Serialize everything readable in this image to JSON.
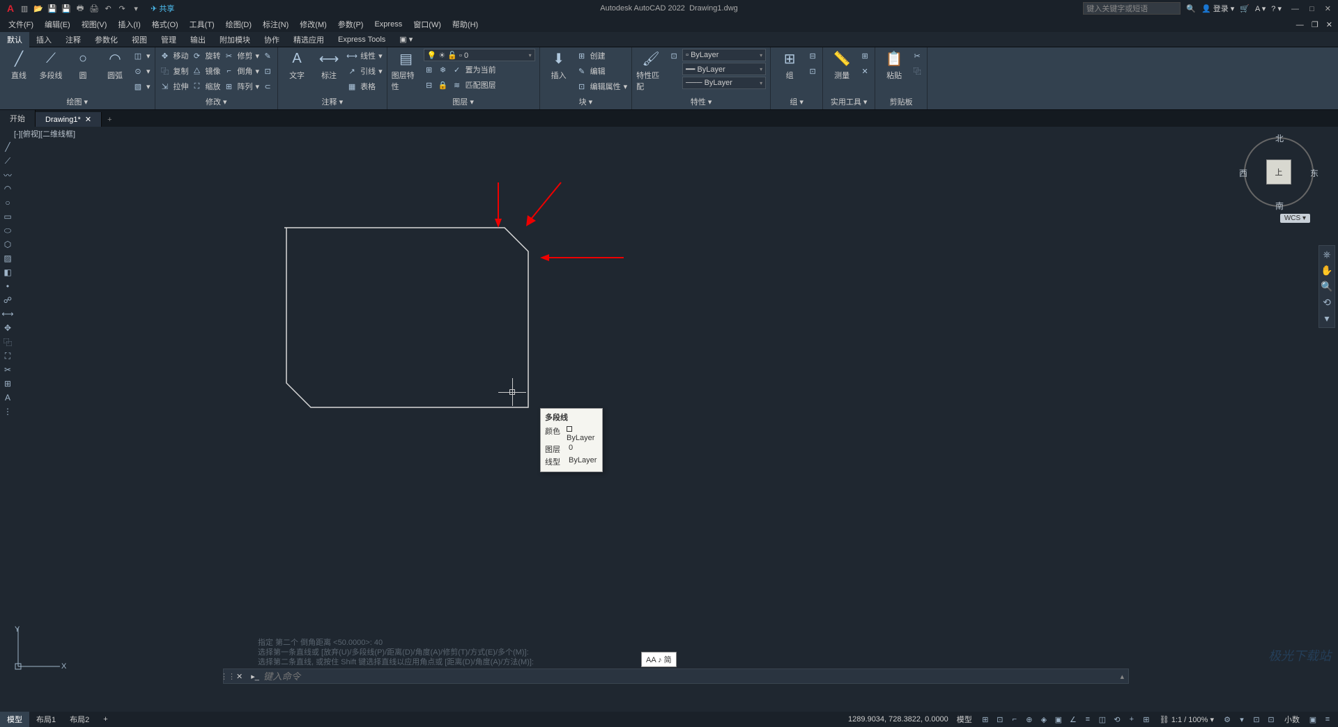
{
  "title": {
    "app": "Autodesk AutoCAD 2022",
    "file": "Drawing1.dwg"
  },
  "qat_share": "共享",
  "search_placeholder": "键入关键字或短语",
  "login": "登录",
  "menus": [
    "文件(F)",
    "编辑(E)",
    "视图(V)",
    "插入(I)",
    "格式(O)",
    "工具(T)",
    "绘图(D)",
    "标注(N)",
    "修改(M)",
    "参数(P)",
    "Express",
    "窗口(W)",
    "帮助(H)"
  ],
  "ribbon_tabs": [
    "默认",
    "插入",
    "注释",
    "参数化",
    "视图",
    "管理",
    "输出",
    "附加模块",
    "协作",
    "精选应用",
    "Express Tools"
  ],
  "panels": {
    "draw": {
      "title": "绘图",
      "line": "直线",
      "pline": "多段线",
      "circle": "圆",
      "arc": "圆弧"
    },
    "modify": {
      "title": "修改",
      "move": "移动",
      "rotate": "旋转",
      "trim": "修剪",
      "copy": "复制",
      "mirror": "镜像",
      "fillet": "倒角",
      "stretch": "拉伸",
      "scale": "缩放",
      "array": "阵列"
    },
    "annot": {
      "title": "注释",
      "text": "文字",
      "dim": "标注",
      "linear": "线性",
      "leader": "引线",
      "table": "表格"
    },
    "layers": {
      "title": "图层",
      "props": "图层特性",
      "current": "0",
      "freeze": "冻结",
      "setcurrent": "置为当前",
      "match": "匹配图层"
    },
    "block": {
      "title": "块",
      "insert": "插入",
      "create": "创建",
      "edit": "编辑",
      "attr": "编辑属性"
    },
    "props": {
      "title": "特性",
      "match": "特性匹配",
      "bylayer": "ByLayer"
    },
    "group": {
      "title": "组",
      "lbl": "组"
    },
    "util": {
      "title": "实用工具",
      "measure": "测量"
    },
    "clip": {
      "title": "剪贴板",
      "paste": "粘贴"
    }
  },
  "filetabs": {
    "start": "开始",
    "drawing": "Drawing1*"
  },
  "viewport": "[-][俯视][二维线框]",
  "tooltip": {
    "title": "多段线",
    "color_lbl": "颜色",
    "color_val": "ByLayer",
    "layer_lbl": "图层",
    "layer_val": "0",
    "ltype_lbl": "线型",
    "ltype_val": "ByLayer"
  },
  "viewcube": {
    "n": "北",
    "s": "南",
    "e": "东",
    "w": "西",
    "top": "上",
    "wcs": "WCS"
  },
  "cmdhist": {
    "l1": "指定 第二个 倒角距离 <50.0000>: 40",
    "l2": "选择第一条直线或 [放弃(U)/多段线(P)/距离(D)/角度(A)/修剪(T)/方式(E)/多个(M)]:",
    "l3": "选择第二条直线, 或按住 Shift 键选择直线以应用角点或 [距离(D)/角度(A)/方法(M)]:"
  },
  "cmdline_placeholder": "键入命令",
  "ime": "AA ♪ 简",
  "status": {
    "model": "模型",
    "layout1": "布局1",
    "layout2": "布局2",
    "coords": "1289.9034, 728.3822, 0.0000",
    "model2": "模型",
    "scale": "1:1 / 100%",
    "dec": "小数"
  },
  "watermark": "极光下载站"
}
